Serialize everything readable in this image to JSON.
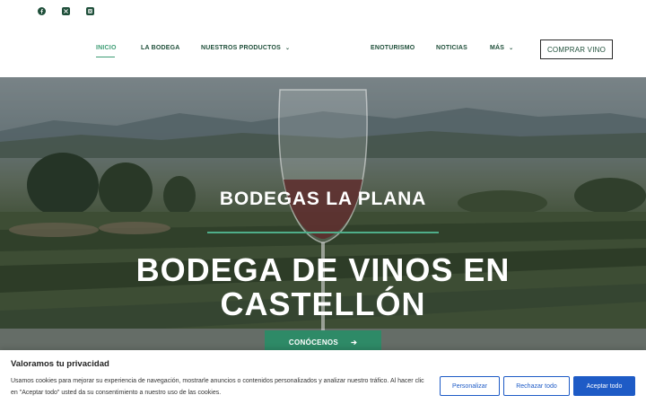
{
  "social": [
    {
      "name": "facebook-icon"
    },
    {
      "name": "x-twitter-icon"
    },
    {
      "name": "instagram-icon"
    }
  ],
  "nav": {
    "inicio": "INICIO",
    "la_bodega": "LA BODEGA",
    "nuestros_productos": "NUESTROS PRODUCTOS",
    "enoturismo": "ENOTURISMO",
    "noticias": "NOTICIAS",
    "mas": "MÁS",
    "chevron": "⌄"
  },
  "buy_button": "COMPRAR VINO",
  "hero": {
    "kicker": "BODEGAS LA PLANA",
    "title_line1": "BODEGA DE VINOS EN",
    "title_line2": "CASTELLÓN",
    "cta": "CONÓCENOS",
    "cta_arrow": "➔"
  },
  "cookie": {
    "title": "Valoramos tu privacidad",
    "text": "Usamos cookies para mejorar su experiencia de navegación, mostrarle anuncios o contenidos personalizados y analizar nuestro tráfico. Al hacer clic en \"Aceptar todo\" usted da su consentimiento a nuestro uso de las cookies.",
    "customize": "Personalizar",
    "reject": "Rechazar todo",
    "accept": "Aceptar todo"
  },
  "colors": {
    "brand_green": "#1f4f3a",
    "accent_green": "#3d9c74",
    "cta_green": "#2e8a67",
    "cookie_blue": "#1e5bc6"
  }
}
